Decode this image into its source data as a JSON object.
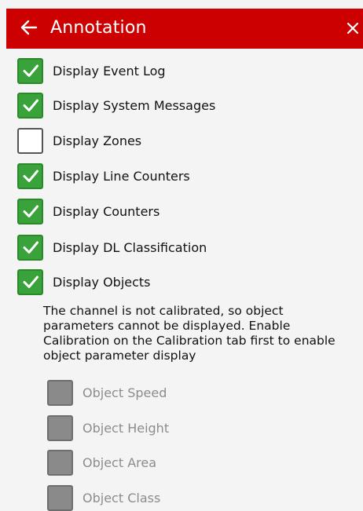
{
  "header": {
    "title": "Annotation",
    "back_icon": "arrow-left-icon",
    "close_icon": "close-icon",
    "color": "#cc0000"
  },
  "options": [
    {
      "label": "Display Event Log",
      "checked": true
    },
    {
      "label": "Display System Messages",
      "checked": true
    },
    {
      "label": "Display Zones",
      "checked": false
    },
    {
      "label": "Display Line Counters",
      "checked": true
    },
    {
      "label": "Display Counters",
      "checked": true
    },
    {
      "label": "Display DL Classification",
      "checked": true
    },
    {
      "label": "Display Objects",
      "checked": true
    }
  ],
  "calibration_note": "The channel is not calibrated, so object parameters cannot be displayed. Enable Calibration on the Calibration tab first to enable object parameter display",
  "object_params": [
    {
      "label": "Object Speed",
      "enabled": false
    },
    {
      "label": "Object Height",
      "enabled": false
    },
    {
      "label": "Object Area",
      "enabled": false
    },
    {
      "label": "Object Class",
      "enabled": false
    }
  ],
  "colors": {
    "checked": "#3aa23a",
    "disabled": "#8a8a8a",
    "disabled_text": "#8c8c8c"
  }
}
